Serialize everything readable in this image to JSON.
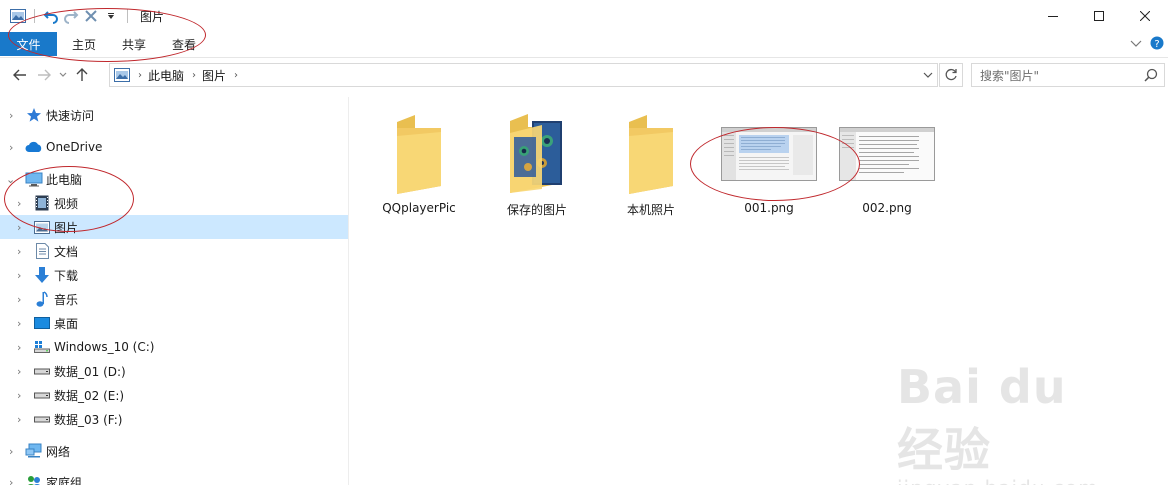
{
  "window": {
    "title": "图片"
  },
  "ribbon": {
    "tabs": [
      {
        "label": "文件",
        "active": true
      },
      {
        "label": "主页"
      },
      {
        "label": "共享"
      },
      {
        "label": "查看"
      }
    ]
  },
  "address": {
    "crumbs": [
      "此电脑",
      "图片"
    ]
  },
  "search": {
    "placeholder": "搜索\"图片\""
  },
  "nav": {
    "items": [
      {
        "label": "快速访问",
        "icon": "star-icon",
        "level": 0
      },
      {
        "label": "OneDrive",
        "icon": "cloud-icon",
        "level": 0
      },
      {
        "label": "此电脑",
        "icon": "computer-icon",
        "level": 0,
        "expanded": true
      },
      {
        "label": "视频",
        "icon": "video-icon",
        "level": 1
      },
      {
        "label": "图片",
        "icon": "pictures-icon",
        "level": 1,
        "selected": true
      },
      {
        "label": "文档",
        "icon": "document-icon",
        "level": 1
      },
      {
        "label": "下载",
        "icon": "download-icon",
        "level": 1
      },
      {
        "label": "音乐",
        "icon": "music-icon",
        "level": 1
      },
      {
        "label": "桌面",
        "icon": "desktop-icon",
        "level": 1
      },
      {
        "label": "Windows_10 (C:)",
        "icon": "system-drive-icon",
        "level": 1
      },
      {
        "label": "数据_01 (D:)",
        "icon": "drive-icon",
        "level": 1
      },
      {
        "label": "数据_02 (E:)",
        "icon": "drive-icon",
        "level": 1
      },
      {
        "label": "数据_03 (F:)",
        "icon": "drive-icon",
        "level": 1
      },
      {
        "label": "网络",
        "icon": "network-icon",
        "level": 0
      },
      {
        "label": "家庭组",
        "icon": "homegroup-icon",
        "level": 0
      }
    ]
  },
  "files": [
    {
      "name": "QQplayerPic",
      "type": "folder"
    },
    {
      "name": "保存的图片",
      "type": "folder-with-images"
    },
    {
      "name": "本机照片",
      "type": "folder"
    },
    {
      "name": "001.png",
      "type": "image"
    },
    {
      "name": "002.png",
      "type": "image"
    }
  ],
  "watermark": {
    "brand": "Bai du 经验",
    "url": "jingyan.baidu.com"
  },
  "colors": {
    "accent": "#1979ca",
    "selection": "#cce8ff",
    "folder": "#f8d775",
    "annotation": "#c0282d"
  }
}
